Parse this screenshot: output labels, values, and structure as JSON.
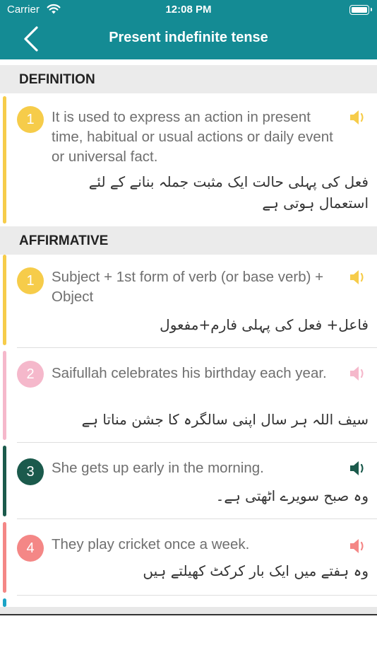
{
  "status_bar": {
    "carrier": "Carrier",
    "time": "12:08 PM"
  },
  "header": {
    "title": "Present indefinite tense",
    "back_icon": "chevron-left-icon"
  },
  "sections": [
    {
      "label": "DEFINITION"
    },
    {
      "label": "AFFIRMATIVE"
    }
  ],
  "definition": {
    "number": "1",
    "color": "#f6cc4a",
    "english": "It is used to express an action in present time, habitual or usual actions or daily event or universal fact.",
    "urdu": "فعل کی پہلی حالت ایک مثبت جملہ بنانے کے لئے استعمال ہوتی ہے"
  },
  "affirmative": [
    {
      "number": "1",
      "color": "#f6cc4a",
      "english": "Subject + 1st form of verb (or base verb) + Object",
      "urdu": "فاعل+  فعل کی پہلی فارم+مفعول"
    },
    {
      "number": "2",
      "color": "#f5b8cb",
      "english": "Saifullah celebrates his birthday each year.",
      "urdu": "سیف اللہ ہر سال  اپنی سالگرہ کا  جشن مناتا ہے"
    },
    {
      "number": "3",
      "color": "#1b5a4c",
      "english": "She gets up early in the morning.",
      "urdu": "وہ صبح سویرے اٹھتی ہے۔"
    },
    {
      "number": "4",
      "color": "#f48786",
      "english": "They play cricket once a week.",
      "urdu": "وہ ہفتے میں ایک بار کرکٹ کھیلتے ہیں"
    }
  ],
  "partial_bar_color": "#1aa3c6"
}
